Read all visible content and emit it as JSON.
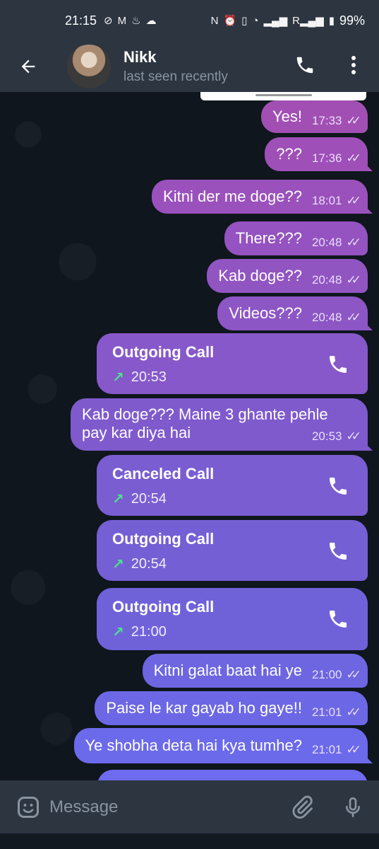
{
  "status_bar": {
    "time": "21:15",
    "battery": "99%",
    "icons": [
      "check-circle-icon",
      "gmail-icon",
      "fire-icon",
      "cloud-icon",
      "nfc-icon",
      "alarm-icon",
      "vibrate-icon",
      "wifi-icon",
      "signal-icon",
      "roaming-signal-icon",
      "battery-icon"
    ],
    "roaming_label": "R"
  },
  "header": {
    "contact_name": "Nikk",
    "status": "last seen recently"
  },
  "messages": [
    {
      "type": "text",
      "text": "Yes!",
      "time": "17:33"
    },
    {
      "type": "text",
      "text": "???",
      "time": "17:36"
    },
    {
      "type": "text",
      "text": "Kitni der me doge??",
      "time": "18:01"
    },
    {
      "type": "text",
      "text": "There???",
      "time": "20:48"
    },
    {
      "type": "text",
      "text": "Kab doge??",
      "time": "20:48"
    },
    {
      "type": "text",
      "text": "Videos???",
      "time": "20:48"
    },
    {
      "type": "call",
      "title": "Outgoing Call",
      "time": "20:53"
    },
    {
      "type": "text",
      "line1": "Kab doge??? Maine 3 ghante pehle",
      "line2": "pay kar diya hai",
      "time": "20:53"
    },
    {
      "type": "call",
      "title": "Canceled Call",
      "time": "20:54"
    },
    {
      "type": "call",
      "title": "Outgoing Call",
      "time": "20:54"
    },
    {
      "type": "call",
      "title": "Outgoing Call",
      "time": "21:00"
    },
    {
      "type": "text",
      "text": "Kitni galat baat hai ye",
      "time": "21:00"
    },
    {
      "type": "text",
      "text": "Paise le kar gayab ho gaye!!",
      "time": "21:01"
    },
    {
      "type": "text",
      "text": "Ye shobha deta hai kya tumhe?",
      "time": "21:01"
    }
  ],
  "composer": {
    "placeholder": "Message"
  },
  "colors": {
    "bar_bg": "#2c3540",
    "chat_bg": "#0f161d",
    "bubble_top": "#a24fb4",
    "bubble_bottom": "#6f6bf0",
    "call_arrow": "#4de08f"
  }
}
